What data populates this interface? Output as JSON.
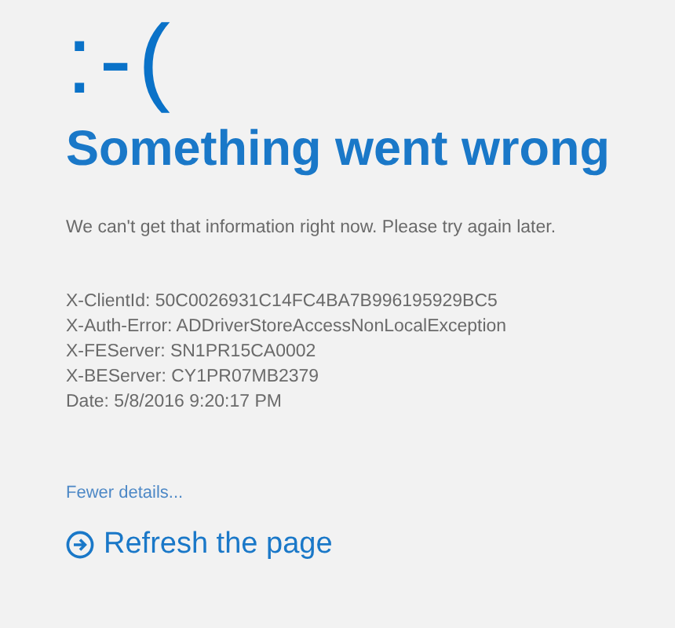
{
  "emoticon": ":-(",
  "title": "Something went wrong",
  "message": "We can't get that information right now. Please try again later.",
  "details": [
    "X-ClientId: 50C0026931C14FC4BA7B996195929BC5",
    "X-Auth-Error: ADDriverStoreAccessNonLocalException",
    "X-FEServer: SN1PR15CA0002",
    "X-BEServer: CY1PR07MB2379",
    "Date: 5/8/2016 9:20:17 PM"
  ],
  "details_toggle": "Fewer details...",
  "refresh": "Refresh the page"
}
